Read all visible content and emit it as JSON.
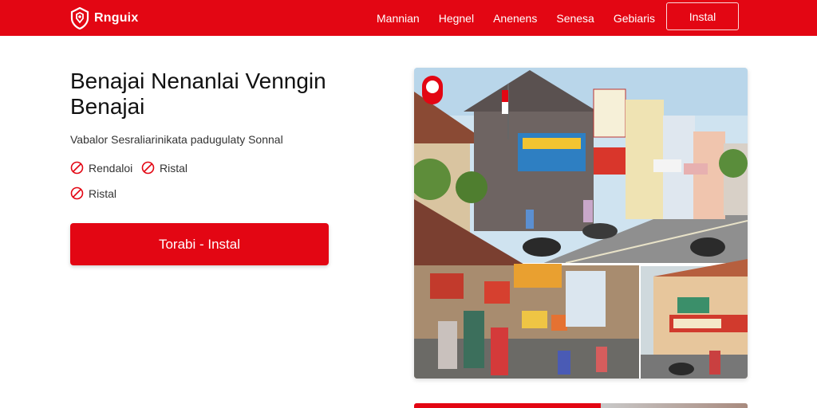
{
  "header": {
    "brand": "Rnguix",
    "nav": [
      "Mannian",
      "Hegnel",
      "Anenens",
      "Senesa",
      "Gebiaris"
    ],
    "install_label": "Instal"
  },
  "hero": {
    "title": "Benajai Nenanlai Venngin Benajai",
    "subtitle": "Vabalor Sesraliarinikata padugulaty Sonnal",
    "features": [
      "Rendaloi",
      "Ristal",
      "Ristal"
    ],
    "cta_label": "Torabi - Instal"
  },
  "colors": {
    "brand_red": "#e30613",
    "white": "#ffffff"
  },
  "icons": {
    "brand": "shield-logo-icon",
    "feature": "prohibit-icon"
  }
}
